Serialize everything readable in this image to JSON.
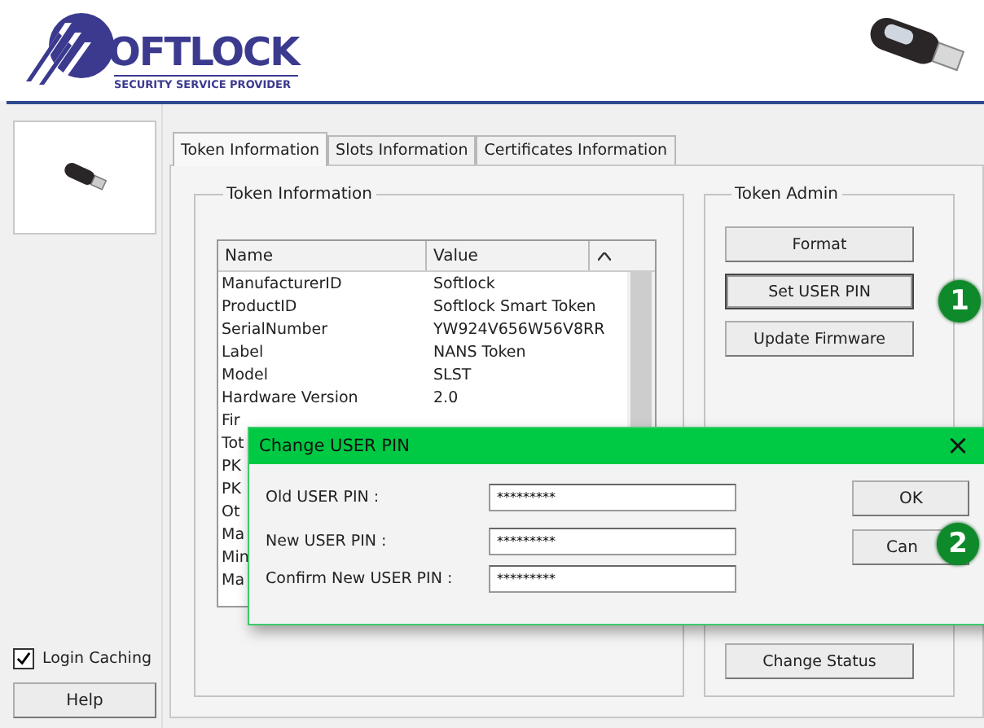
{
  "header": {
    "logo_text": "OFTLOCK",
    "logo_subtitle": "SECURITY SERVICE PROVIDER"
  },
  "sidebar": {
    "login_caching": {
      "label": "Login Caching",
      "checked": true
    },
    "help_button": "Help"
  },
  "tabs": [
    {
      "label": "Token Information",
      "selected": true
    },
    {
      "label": "Slots Information",
      "selected": false
    },
    {
      "label": "Certificates Information",
      "selected": false
    }
  ],
  "token_information": {
    "title": "Token Information",
    "columns": [
      "Name",
      "Value"
    ],
    "rows": [
      {
        "name": "ManufacturerID",
        "value": "Softlock"
      },
      {
        "name": "ProductID",
        "value": "Softlock Smart Token"
      },
      {
        "name": "SerialNumber",
        "value": "YW924V656W56V8RR"
      },
      {
        "name": "Label",
        "value": "NANS Token"
      },
      {
        "name": "Model",
        "value": "SLST"
      },
      {
        "name": "Hardware Version",
        "value": "2.0"
      },
      {
        "name": "Fir",
        "value": ""
      },
      {
        "name": "Tot",
        "value": ""
      },
      {
        "name": "PK",
        "value": ""
      },
      {
        "name": "PK",
        "value": ""
      },
      {
        "name": "Ot",
        "value": ""
      },
      {
        "name": "Ma",
        "value": ""
      },
      {
        "name": "Min",
        "value": ""
      },
      {
        "name": "Ma",
        "value": ""
      }
    ]
  },
  "token_admin": {
    "title": "Token Admin",
    "buttons": [
      {
        "label": "Format",
        "kind": "top",
        "focused": false
      },
      {
        "label": "Set USER PIN",
        "kind": "top",
        "focused": true
      },
      {
        "label": "Update Firmware",
        "kind": "top",
        "focused": false
      },
      {
        "label": "Change Status",
        "kind": "bottom",
        "focused": false
      }
    ]
  },
  "dialog": {
    "title": "Change USER PIN",
    "close": "×",
    "fields": [
      {
        "label": "Old USER PIN :",
        "value": "*********"
      },
      {
        "label": "New USER PIN :",
        "value": "*********"
      },
      {
        "label": "Confirm New USER PIN :",
        "value": "*********"
      }
    ],
    "buttons": [
      "OK",
      "Can"
    ]
  },
  "step_badges": [
    "1",
    "2"
  ]
}
